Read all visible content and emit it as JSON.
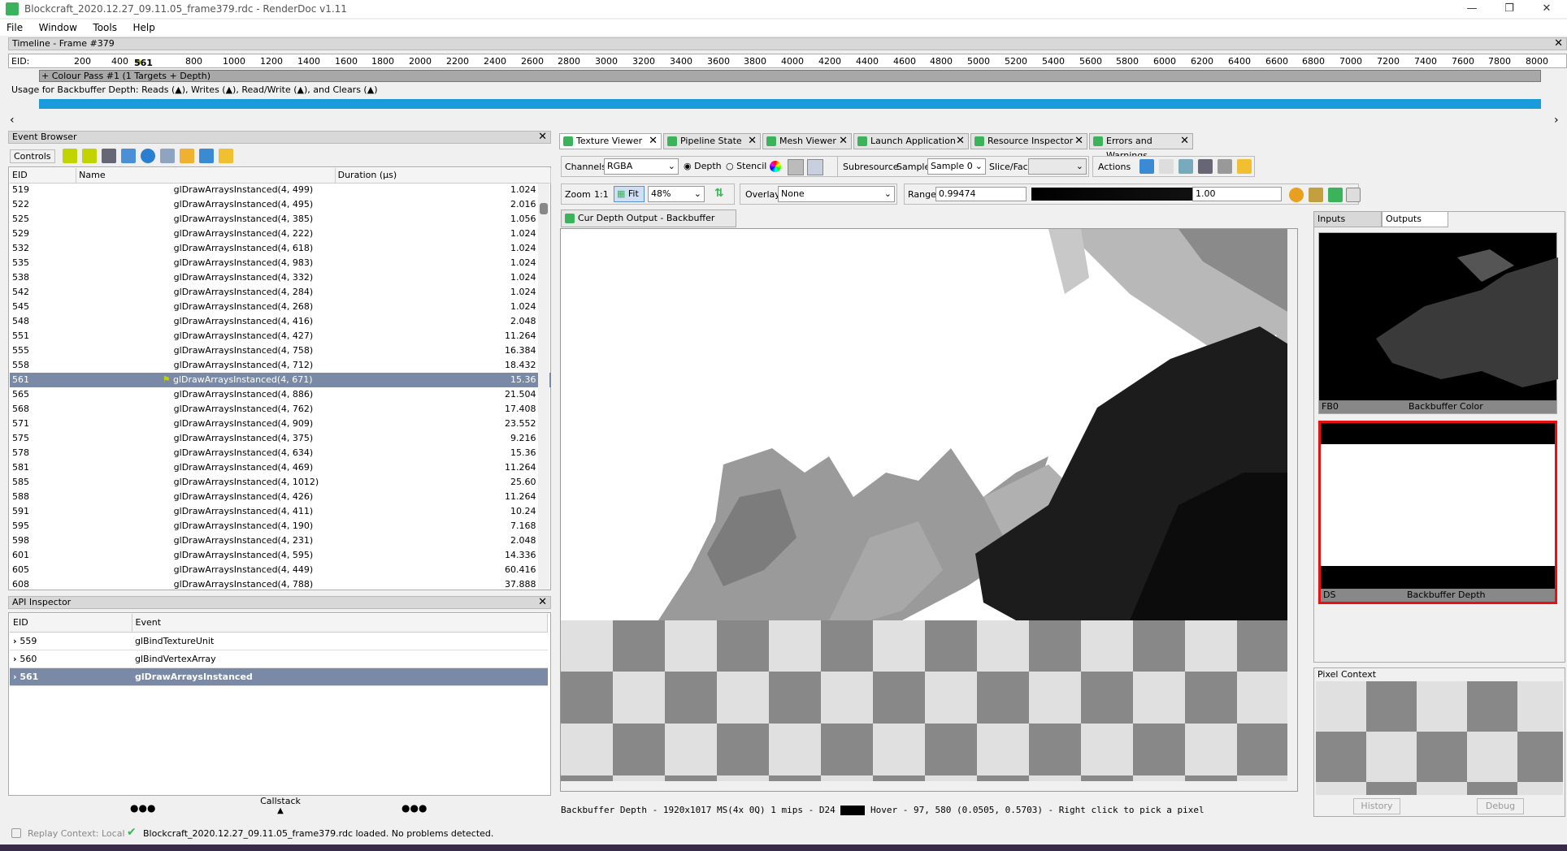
{
  "window": {
    "title": "Blockcraft_2020.12.27_09.11.05_frame379.rdc - RenderDoc v1.11",
    "min": "—",
    "max": "❐",
    "close": "✕"
  },
  "menu": [
    "File",
    "Window",
    "Tools",
    "Help"
  ],
  "timeline": {
    "title": "Timeline - Frame #379",
    "eid_label": "EID:",
    "marker": "561",
    "ticks": [
      "200",
      "400",
      "800",
      "1000",
      "1200",
      "1400",
      "1600",
      "1800",
      "2000",
      "2200",
      "2400",
      "2600",
      "2800",
      "3000",
      "3200",
      "3400",
      "3600",
      "3800",
      "4000",
      "4200",
      "4400",
      "4600",
      "4800",
      "5000",
      "5200",
      "5400",
      "5600",
      "5800",
      "6000",
      "6200",
      "6400",
      "6600",
      "6800",
      "7000",
      "7200",
      "7400",
      "7600",
      "7800",
      "8000"
    ],
    "pass_label": "+ Colour Pass #1 (1 Targets + Depth)",
    "usage": "Usage for Backbuffer Depth: Reads (▲), Writes (▲), Read/Write (▲), and Clears (▲)"
  },
  "event_browser": {
    "title": "Event Browser",
    "controls_label": "Controls",
    "columns": [
      "EID",
      "Name",
      "Duration (µs)"
    ],
    "rows": [
      {
        "eid": "519",
        "name": "glDrawArraysInstanced(4, 499)",
        "dur": "1.024"
      },
      {
        "eid": "522",
        "name": "glDrawArraysInstanced(4, 495)",
        "dur": "2.016"
      },
      {
        "eid": "525",
        "name": "glDrawArraysInstanced(4, 385)",
        "dur": "1.056"
      },
      {
        "eid": "529",
        "name": "glDrawArraysInstanced(4, 222)",
        "dur": "1.024"
      },
      {
        "eid": "532",
        "name": "glDrawArraysInstanced(4, 618)",
        "dur": "1.024"
      },
      {
        "eid": "535",
        "name": "glDrawArraysInstanced(4, 983)",
        "dur": "1.024"
      },
      {
        "eid": "538",
        "name": "glDrawArraysInstanced(4, 332)",
        "dur": "1.024"
      },
      {
        "eid": "542",
        "name": "glDrawArraysInstanced(4, 284)",
        "dur": "1.024"
      },
      {
        "eid": "545",
        "name": "glDrawArraysInstanced(4, 268)",
        "dur": "1.024"
      },
      {
        "eid": "548",
        "name": "glDrawArraysInstanced(4, 416)",
        "dur": "2.048"
      },
      {
        "eid": "551",
        "name": "glDrawArraysInstanced(4, 427)",
        "dur": "11.264"
      },
      {
        "eid": "555",
        "name": "glDrawArraysInstanced(4, 758)",
        "dur": "16.384"
      },
      {
        "eid": "558",
        "name": "glDrawArraysInstanced(4, 712)",
        "dur": "18.432"
      },
      {
        "eid": "561",
        "name": "glDrawArraysInstanced(4, 671)",
        "dur": "15.36",
        "selected": true
      },
      {
        "eid": "565",
        "name": "glDrawArraysInstanced(4, 886)",
        "dur": "21.504"
      },
      {
        "eid": "568",
        "name": "glDrawArraysInstanced(4, 762)",
        "dur": "17.408"
      },
      {
        "eid": "571",
        "name": "glDrawArraysInstanced(4, 909)",
        "dur": "23.552"
      },
      {
        "eid": "575",
        "name": "glDrawArraysInstanced(4, 375)",
        "dur": "9.216"
      },
      {
        "eid": "578",
        "name": "glDrawArraysInstanced(4, 634)",
        "dur": "15.36"
      },
      {
        "eid": "581",
        "name": "glDrawArraysInstanced(4, 469)",
        "dur": "11.264"
      },
      {
        "eid": "585",
        "name": "glDrawArraysInstanced(4, 1012)",
        "dur": "25.60"
      },
      {
        "eid": "588",
        "name": "glDrawArraysInstanced(4, 426)",
        "dur": "11.264"
      },
      {
        "eid": "591",
        "name": "glDrawArraysInstanced(4, 411)",
        "dur": "10.24"
      },
      {
        "eid": "595",
        "name": "glDrawArraysInstanced(4, 190)",
        "dur": "7.168"
      },
      {
        "eid": "598",
        "name": "glDrawArraysInstanced(4, 231)",
        "dur": "2.048"
      },
      {
        "eid": "601",
        "name": "glDrawArraysInstanced(4, 595)",
        "dur": "14.336"
      },
      {
        "eid": "605",
        "name": "glDrawArraysInstanced(4, 449)",
        "dur": "60.416"
      },
      {
        "eid": "608",
        "name": "glDrawArraysInstanced(4, 788)",
        "dur": "37.888"
      }
    ]
  },
  "api_inspector": {
    "title": "API Inspector",
    "columns": [
      "EID",
      "Event"
    ],
    "rows": [
      {
        "eid": "559",
        "event": "glBindTextureUnit"
      },
      {
        "eid": "560",
        "event": "glBindVertexArray"
      },
      {
        "eid": "561",
        "event": "glDrawArraysInstanced",
        "selected": true
      }
    ],
    "callstack": "Callstack",
    "dots": "●●●"
  },
  "tabs": [
    "Texture Viewer",
    "Pipeline State",
    "Mesh Viewer",
    "Launch Application",
    "Resource Inspector",
    "Errors and Warnings"
  ],
  "texture_viewer": {
    "channels_label": "Channels",
    "channels_value": "RGBA",
    "depth_label": "Depth",
    "stencil_label": "Stencil",
    "subresource_label": "Subresource",
    "sample_label": "Sample",
    "sample_value": "Sample 0",
    "slice_label": "Slice/Face",
    "actions_label": "Actions",
    "zoom_label": "Zoom",
    "zoom_1to1": "1:1",
    "fit_label": "Fit",
    "zoom_value": "48%",
    "overlay_label": "Overlay",
    "overlay_value": "None",
    "range_label": "Range",
    "range_min": "0.99474",
    "range_max": "1.00",
    "output_tab": "Cur Depth Output - Backbuffer Depth",
    "status_text": "Backbuffer Depth - 1920x1017 MS(4x 0Q) 1 mips - D24",
    "hover_text": "Hover -    97,  580 (0.0505, 0.5703)  - Right click to pick a pixel"
  },
  "thumbnails": {
    "inputs_tab": "Inputs",
    "outputs_tab": "Outputs",
    "items": [
      {
        "slot": "FB0",
        "name": "Backbuffer Color"
      },
      {
        "slot": "DS",
        "name": "Backbuffer Depth",
        "selected": true
      }
    ]
  },
  "pixel_context": {
    "title": "Pixel Context",
    "history": "History",
    "debug": "Debug"
  },
  "status": {
    "replay": "Replay Context: Local",
    "message": "Blockcraft_2020.12.27_09.11.05_frame379.rdc loaded. No problems detected."
  },
  "colors": {
    "accent": "#3bb35b",
    "selection": "#7a8aa6",
    "timeline_blue": "#1a9cdc",
    "highlight": "#e81010"
  }
}
